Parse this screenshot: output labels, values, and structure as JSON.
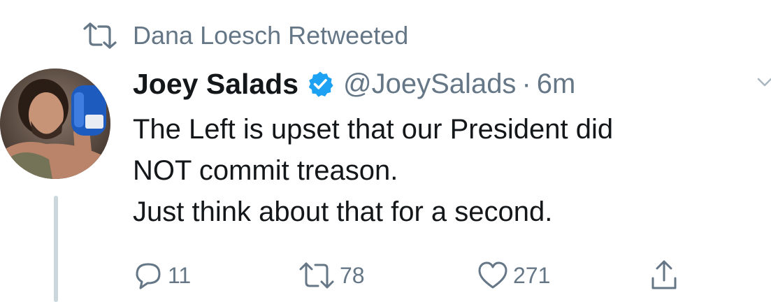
{
  "retweet_context": {
    "icon": "retweet-icon",
    "text": "Dana Loesch Retweeted"
  },
  "tweet": {
    "author": {
      "display_name": "Joey Salads",
      "verified": true,
      "handle": "@JoeySalads",
      "avatar_icon": "avatar-photo"
    },
    "separator": "·",
    "timestamp": "6m",
    "text_lines": [
      "The Left is upset that our President did",
      "NOT commit treason.",
      "Just think about that for a second."
    ],
    "actions": {
      "reply": {
        "icon": "reply-icon",
        "count": "11"
      },
      "retweet": {
        "icon": "retweet-icon",
        "count": "78"
      },
      "like": {
        "icon": "heart-icon",
        "count": "271"
      },
      "share": {
        "icon": "share-icon"
      }
    }
  },
  "colors": {
    "primary_text": "#14171a",
    "secondary_text": "#657786",
    "verified_blue": "#1da1f2",
    "thread_line": "#ccd6dd"
  }
}
